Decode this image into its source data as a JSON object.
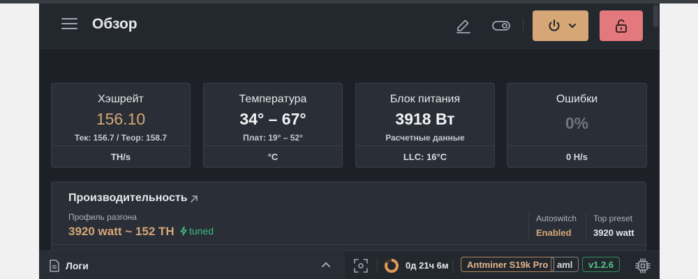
{
  "header": {
    "title": "Обзор"
  },
  "cards": [
    {
      "label": "Хэшрейт",
      "value": "156.10",
      "sub": "Тек: 156.7 / Теор: 158.7",
      "unit": "TH/s"
    },
    {
      "label": "Температура",
      "value": "34° – 67°",
      "sub": "Плат: 19° – 52°",
      "unit": "°C"
    },
    {
      "label": "Блок питания",
      "value": "3918 Вт",
      "sub": "Расчетные данные",
      "unit": "LLC: 16°C"
    },
    {
      "label": "Ошибки",
      "value": "0%",
      "sub": "",
      "unit": "0 H/s"
    }
  ],
  "performance": {
    "title": "Производительность",
    "profile_label": "Профиль разгона",
    "profile_value": "3920 watt ~ 152 TH",
    "tuned_label": "tuned",
    "autoswitch_label": "Autoswitch",
    "autoswitch_value": "Enabled",
    "top_preset_label": "Top preset",
    "top_preset_value": "3920 watt"
  },
  "bottom": {
    "logs_label": "Логи",
    "uptime": "0д 21ч 6м",
    "model": "Antminer S19k Pro",
    "firmware": "aml",
    "version": "v1.2.6"
  },
  "icons": {
    "menu": "hamburger-icon",
    "edit": "pencil-icon",
    "toggle": "toggle-icon",
    "power": "power-icon",
    "lock": "unlock-icon",
    "external": "external-link-icon",
    "tuned": "bolt-icon",
    "logs": "document-icon",
    "expand": "chevron-up-icon",
    "focus": "focus-icon",
    "uptime": "uptime-ring-icon",
    "chip": "chip-icon"
  },
  "colors": {
    "accent": "#d6a676",
    "danger": "#e3797f",
    "success": "#3fb97a",
    "background": "#1d2127",
    "card": "#2a2f37",
    "muted_error": "#6f757d"
  }
}
